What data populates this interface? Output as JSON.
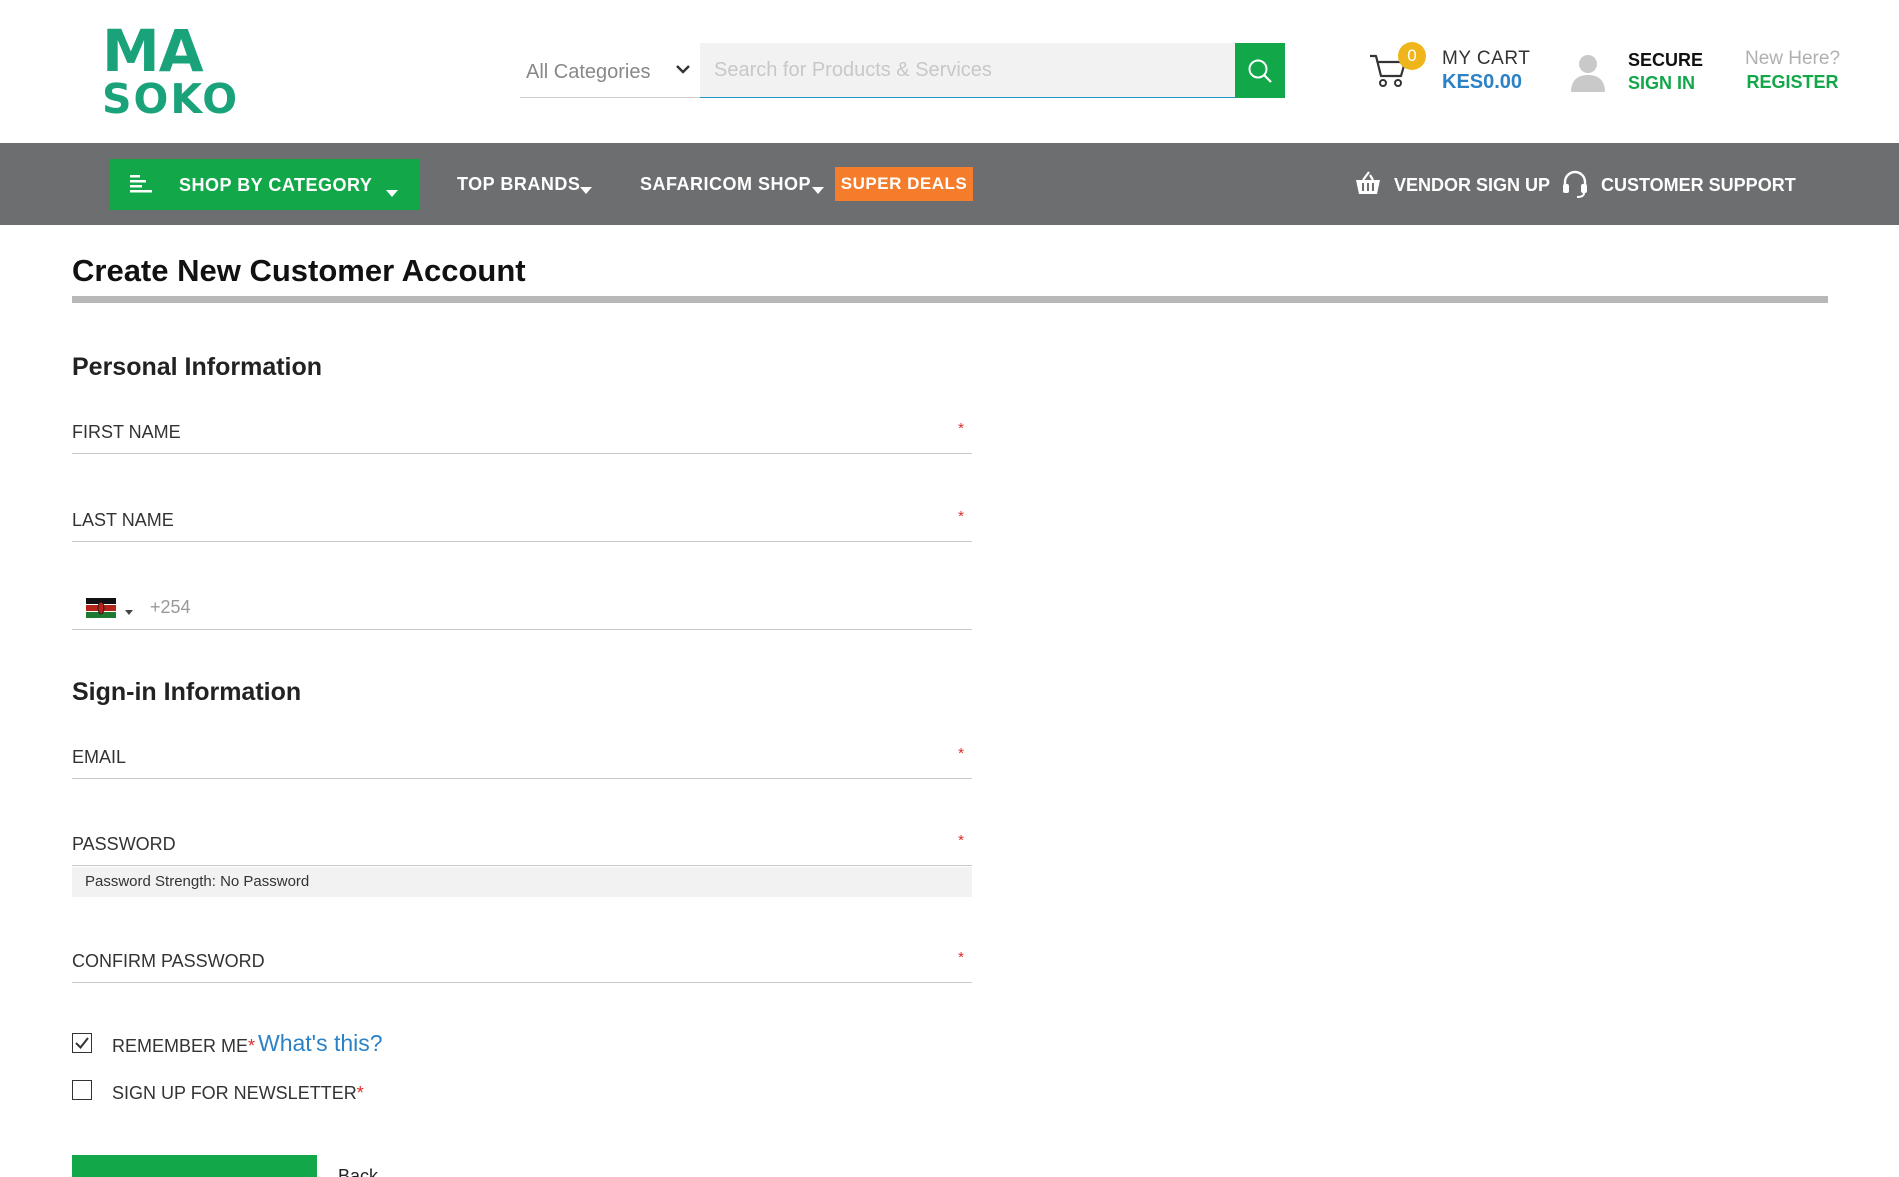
{
  "header": {
    "logo_top": "MA",
    "logo_bottom": "SOKO",
    "category_select": "All Categories",
    "search_placeholder": "Search for Products & Services",
    "cart": {
      "count": "0",
      "label": "MY CART",
      "amount": "KES0.00"
    },
    "account": {
      "secure": "SECURE",
      "signin": "SIGN IN"
    },
    "register": {
      "new_here": "New Here?",
      "register": "REGISTER"
    }
  },
  "nav": {
    "shop_by_category": "SHOP BY CATEGORY",
    "top_brands": "TOP BRANDS",
    "safaricom_shop": "SAFARICOM SHOP",
    "super_deals": "SUPER DEALS",
    "vendor_signup": "VENDOR SIGN UP",
    "customer_support": "CUSTOMER SUPPORT"
  },
  "main": {
    "title": "Create New Customer Account",
    "personal_info": {
      "heading": "Personal Information",
      "first_name": "FIRST NAME",
      "last_name": "LAST NAME",
      "phone_code": "+254"
    },
    "signin_info": {
      "heading": "Sign-in Information",
      "email": "EMAIL",
      "password": "PASSWORD",
      "password_strength": "Password Strength: No Password",
      "confirm_password": "CONFIRM PASSWORD"
    },
    "required_mark": "*",
    "remember_me": {
      "label": "REMEMBER ME",
      "checked": true,
      "whats_this": "What's this?"
    },
    "newsletter": {
      "label": "SIGN UP FOR NEWSLETTER",
      "checked": false
    },
    "back_label": "Back"
  },
  "colors": {
    "brand_green": "#12a84a",
    "logo_green": "#1aa37a",
    "nav_gray": "#6d6e70",
    "deals_orange": "#f57c2a",
    "link_blue": "#2c82c5",
    "required_red": "#e02b27",
    "badge_yellow": "#f0b51b"
  },
  "icons": [
    "search-icon",
    "cart-icon",
    "user-icon",
    "menu-icon",
    "chevron-down-icon",
    "basket-icon",
    "headset-icon",
    "kenya-flag-icon",
    "checkbox-checked-icon"
  ]
}
